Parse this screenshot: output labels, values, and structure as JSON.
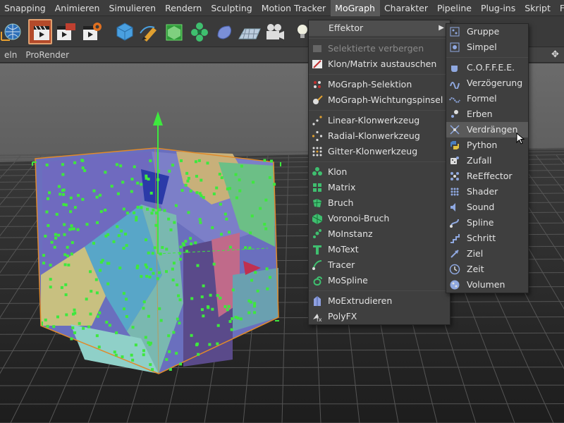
{
  "menubar": [
    {
      "label": "Snapping"
    },
    {
      "label": "Animieren"
    },
    {
      "label": "Simulieren"
    },
    {
      "label": "Rendern"
    },
    {
      "label": "Sculpting"
    },
    {
      "label": "Motion Tracker"
    },
    {
      "label": "MoGraph"
    },
    {
      "label": "Charakter"
    },
    {
      "label": "Pipeline"
    },
    {
      "label": "Plug-ins"
    },
    {
      "label": "Skript"
    },
    {
      "label": "Fenster"
    }
  ],
  "subbar": {
    "item1": "eln",
    "item2": "ProRender"
  },
  "mograph_menu": {
    "effektor": "Effektor",
    "hide_selected": "Selektierte verbergen",
    "swap": "Klon/Matrix austauschen",
    "selection": "MoGraph-Selektion",
    "weight_brush": "MoGraph-Wichtungspinsel",
    "linear": "Linear-Klonwerkzeug",
    "radial": "Radial-Klonwerkzeug",
    "grid": "Gitter-Klonwerkzeug",
    "klon": "Klon",
    "matrix": "Matrix",
    "bruch": "Bruch",
    "voronoi": "Voronoi-Bruch",
    "moinstanz": "MoInstanz",
    "motext": "MoText",
    "tracer": "Tracer",
    "mospline": "MoSpline",
    "moextrude": "MoExtrudieren",
    "polyfx": "PolyFX"
  },
  "effector_menu": {
    "gruppe": "Gruppe",
    "simpel": "Simpel",
    "coffee": "C.O.F.F.E.E.",
    "verzoegerung": "Verzögerung",
    "formel": "Formel",
    "erben": "Erben",
    "verdraengen": "Verdrängen",
    "python": "Python",
    "zufall": "Zufall",
    "reeffector": "ReEffector",
    "shader": "Shader",
    "sound": "Sound",
    "spline": "Spline",
    "schritt": "Schritt",
    "ziel": "Ziel",
    "zeit": "Zeit",
    "volumen": "Volumen"
  },
  "colors": {
    "accent_green": "#3ee83e",
    "cube_orange": "#e08a2a",
    "menu_bg": "#3f3f3f"
  }
}
